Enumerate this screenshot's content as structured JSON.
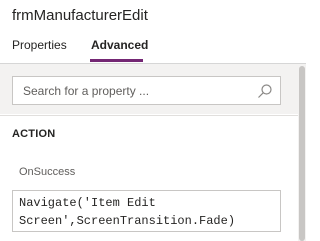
{
  "header": {
    "title": "frmManufacturerEdit"
  },
  "tabs": [
    {
      "label": "Properties",
      "active": false
    },
    {
      "label": "Advanced",
      "active": true
    }
  ],
  "search": {
    "placeholder": "Search for a property ...",
    "value": ""
  },
  "section": {
    "title": "ACTION"
  },
  "property": {
    "label": "OnSuccess",
    "formula_line1": "Navigate('Item Edit",
    "formula_line2": "Screen',ScreenTransition.Fade)"
  },
  "colors": {
    "accent": "#742774",
    "panel_bg": "#f3f2f1",
    "border": "#c8c6c4"
  },
  "icons": {
    "search": "search-icon"
  }
}
